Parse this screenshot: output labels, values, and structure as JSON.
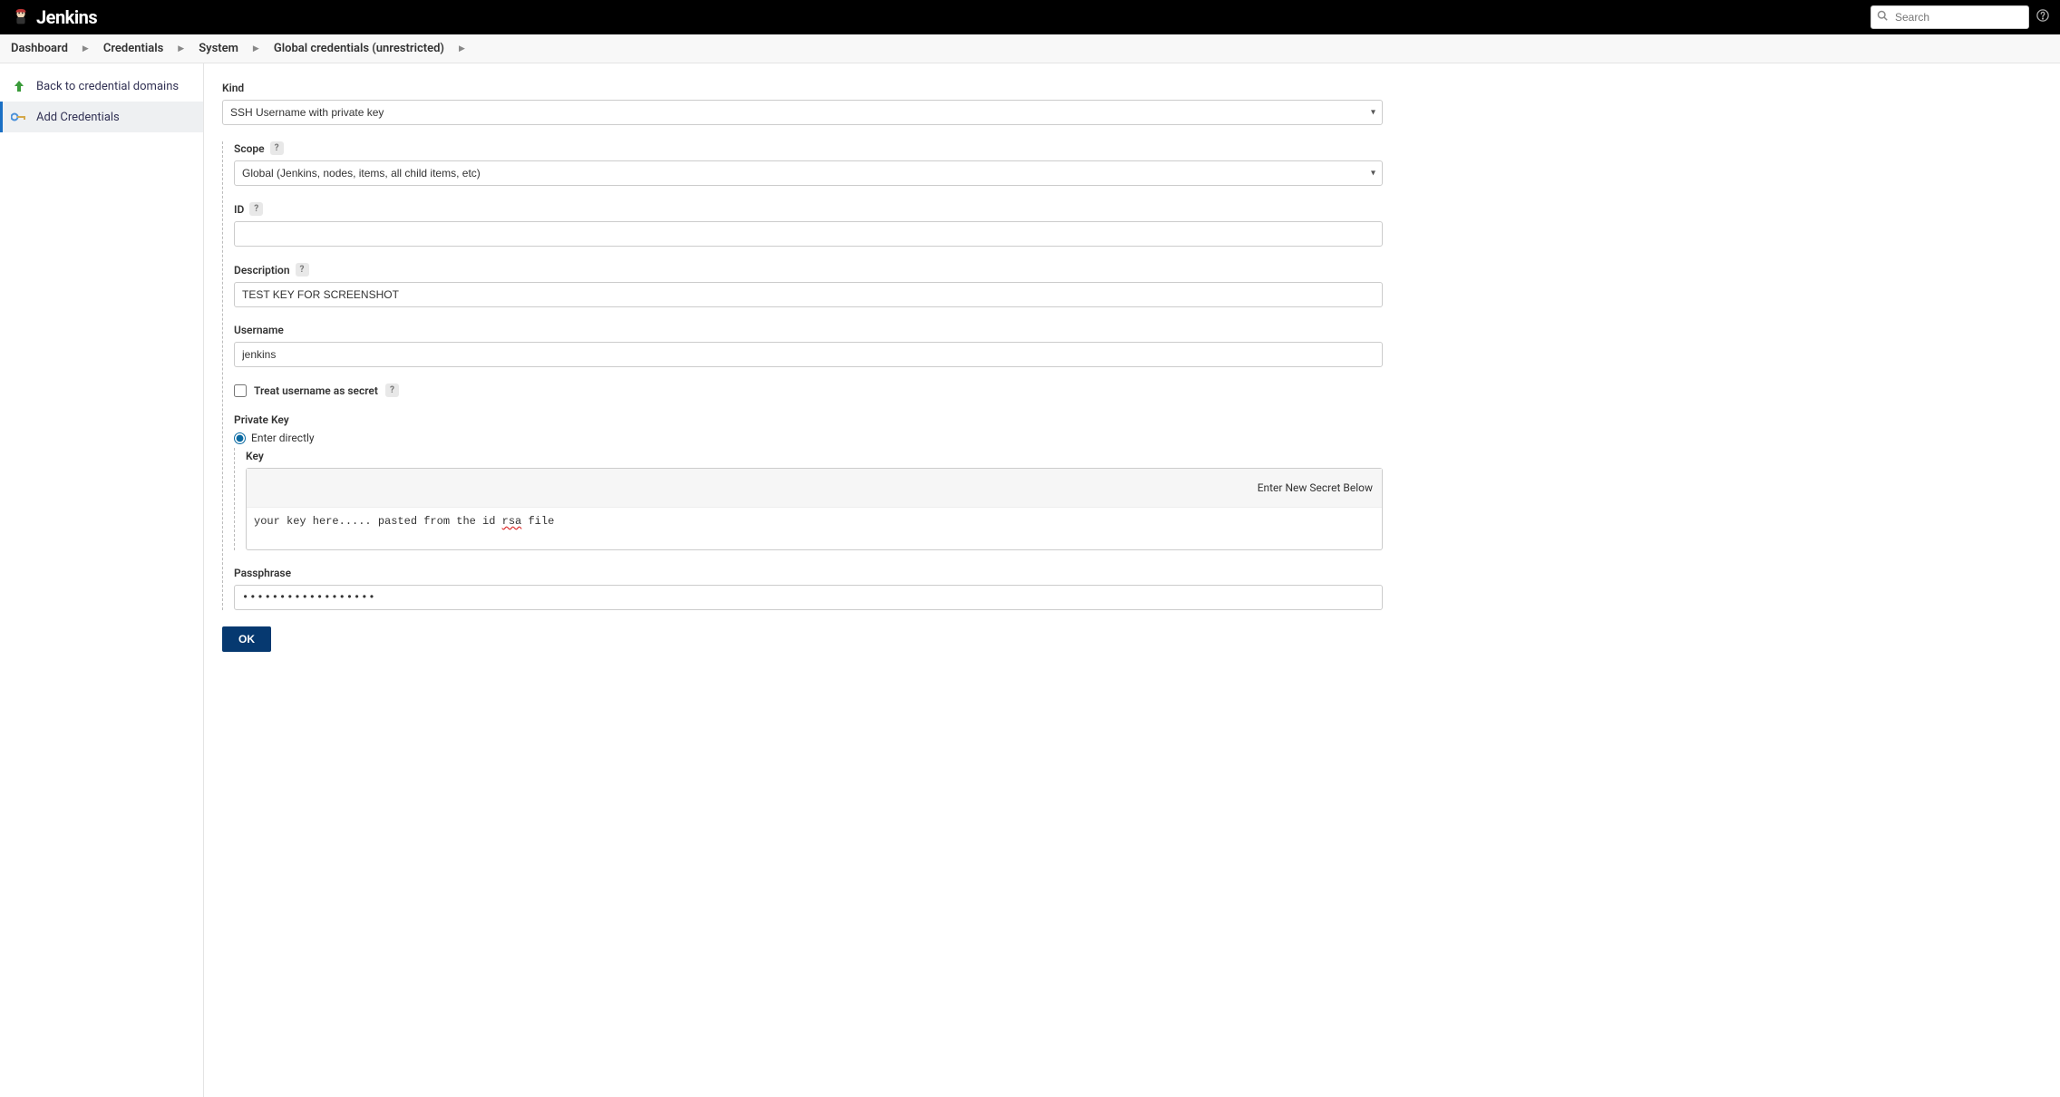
{
  "header": {
    "brand": "Jenkins",
    "search_placeholder": "Search"
  },
  "breadcrumbs": [
    "Dashboard",
    "Credentials",
    "System",
    "Global credentials (unrestricted)"
  ],
  "sidebar": {
    "items": [
      {
        "label": "Back to credential domains"
      },
      {
        "label": "Add Credentials"
      }
    ]
  },
  "form": {
    "kind_label": "Kind",
    "kind_value": "SSH Username with private key",
    "scope_label": "Scope",
    "scope_value": "Global (Jenkins, nodes, items, all child items, etc)",
    "id_label": "ID",
    "id_value": "",
    "description_label": "Description",
    "description_value": "TEST KEY FOR SCREENSHOT",
    "username_label": "Username",
    "username_value": "jenkins",
    "treat_secret_label": "Treat username as secret",
    "private_key_label": "Private Key",
    "enter_directly_label": "Enter directly",
    "key_label": "Key",
    "secret_header": "Enter New Secret Below",
    "key_text_pre": "your key here..... pasted from the id ",
    "key_text_err": "rsa",
    "key_text_post": " file",
    "passphrase_label": "Passphrase",
    "passphrase_value": "••••••••••••••••••",
    "submit_label": "OK"
  }
}
